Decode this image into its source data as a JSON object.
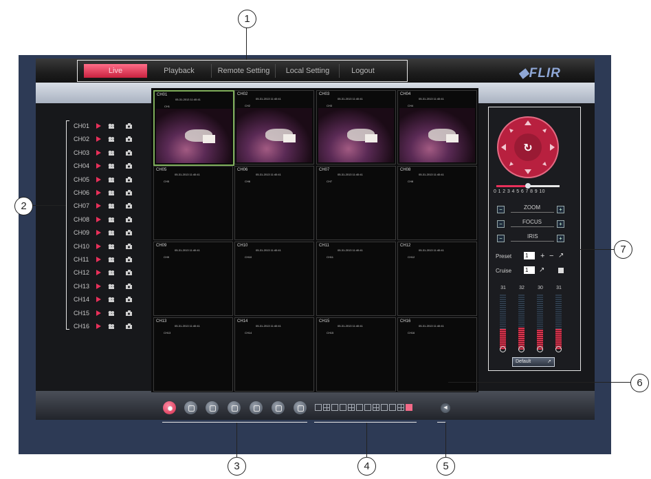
{
  "nav": {
    "tabs": [
      {
        "label": "Live",
        "active": true
      },
      {
        "label": "Playback"
      },
      {
        "label": "Remote Setting"
      },
      {
        "label": "Local Setting"
      },
      {
        "label": "Logout"
      }
    ],
    "logo": "FLIR"
  },
  "channels": [
    "CH01",
    "CH02",
    "CH03",
    "CH04",
    "CH05",
    "CH06",
    "CH07",
    "CH08",
    "CH09",
    "CH10",
    "CH11",
    "CH12",
    "CH13",
    "CH14",
    "CH15",
    "CH16"
  ],
  "grid": {
    "cells": [
      {
        "name": "CH01",
        "timestamp": "05-31-2013 11:40:41",
        "osd": "CH1",
        "has_video": true
      },
      {
        "name": "CH02",
        "timestamp": "05-31-2013 11:40:41",
        "osd": "CH2",
        "has_video": true
      },
      {
        "name": "CH03",
        "timestamp": "05-31-2013 11:40:41",
        "osd": "CH3",
        "has_video": true
      },
      {
        "name": "CH04",
        "timestamp": "05-31-2013 11:40:41",
        "osd": "CH4",
        "has_video": true
      },
      {
        "name": "CH05",
        "timestamp": "05-31-2013 11:40:41",
        "osd": "CH5",
        "has_video": false
      },
      {
        "name": "CH06",
        "timestamp": "05-31-2013 11:40:41",
        "osd": "CH6",
        "has_video": false
      },
      {
        "name": "CH07",
        "timestamp": "05-31-2013 11:40:41",
        "osd": "CH7",
        "has_video": false
      },
      {
        "name": "CH08",
        "timestamp": "05-31-2013 11:40:41",
        "osd": "CH8",
        "has_video": false
      },
      {
        "name": "CH09",
        "timestamp": "05-31-2013 11:40:41",
        "osd": "CH9",
        "has_video": false
      },
      {
        "name": "CH10",
        "timestamp": "05-31-2013 11:40:41",
        "osd": "CH10",
        "has_video": false
      },
      {
        "name": "CH11",
        "timestamp": "05-31-2013 11:40:41",
        "osd": "CH11",
        "has_video": false
      },
      {
        "name": "CH12",
        "timestamp": "05-31-2013 11:40:41",
        "osd": "CH12",
        "has_video": false
      },
      {
        "name": "CH13",
        "timestamp": "05-31-2013 11:40:41",
        "osd": "CH13",
        "has_video": false
      },
      {
        "name": "CH14",
        "timestamp": "05-31-2013 11:40:41",
        "osd": "CH14",
        "has_video": false
      },
      {
        "name": "CH15",
        "timestamp": "05-31-2013 11:40:41",
        "osd": "CH15",
        "has_video": false
      },
      {
        "name": "CH16",
        "timestamp": "05-31-2013 11:40:41",
        "osd": "CH16",
        "has_video": false
      }
    ]
  },
  "ptz": {
    "speed_scale": "0 1 2 3 4 5 6 7 8 9 10",
    "speed_value": 5,
    "zoom_label": "ZOOM",
    "focus_label": "FOCUS",
    "iris_label": "IRIS",
    "preset_label": "Preset",
    "preset_value": "1",
    "cruise_label": "Cruise",
    "cruise_value": "1",
    "meters": [
      {
        "value": "31",
        "level": 0.38
      },
      {
        "value": "32",
        "level": 0.4
      },
      {
        "value": "30",
        "level": 0.36
      },
      {
        "value": "31",
        "level": 0.38
      }
    ],
    "default_label": "Default"
  },
  "callouts": [
    "1",
    "2",
    "3",
    "4",
    "5",
    "6",
    "7"
  ],
  "colors": {
    "accent": "#e8305a",
    "frame": "#2d3a55"
  }
}
